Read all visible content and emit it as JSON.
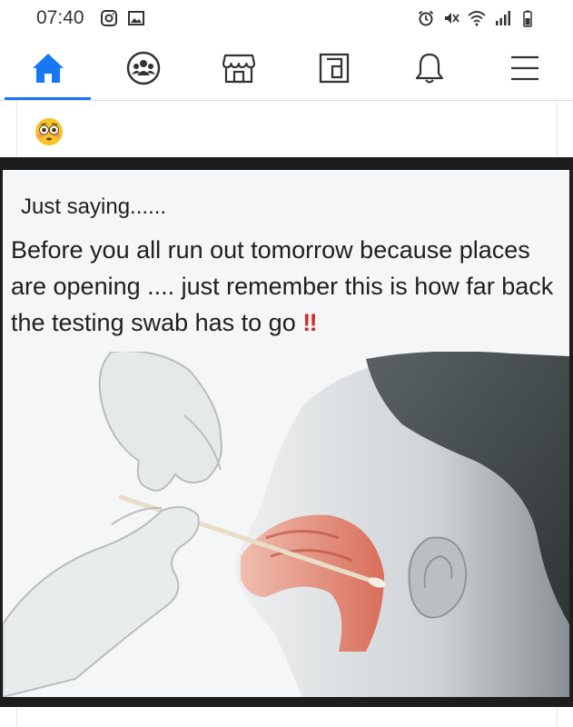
{
  "status_bar": {
    "time": "07:40",
    "left_icons": [
      "instagram-icon",
      "gallery-icon"
    ],
    "right_icons": [
      "alarm-icon",
      "mute-icon",
      "wifi-icon",
      "signal-icon",
      "battery-icon"
    ]
  },
  "nav": {
    "items": [
      {
        "name": "home",
        "icon": "home-icon",
        "active": true
      },
      {
        "name": "groups",
        "icon": "groups-icon",
        "active": false
      },
      {
        "name": "marketplace",
        "icon": "marketplace-icon",
        "active": false
      },
      {
        "name": "watch",
        "icon": "watch-icon",
        "active": false
      },
      {
        "name": "notifications",
        "icon": "bell-icon",
        "active": false
      },
      {
        "name": "menu",
        "icon": "menu-icon",
        "active": false
      }
    ],
    "active_color": "#1877f2"
  },
  "post": {
    "text_emoji": "flushed-face-emoji",
    "image": {
      "line1": "Just saying......",
      "line2": "Before you all run out tomorrow because places are opening .... just remember this is how far back the testing swab has to go",
      "exclaim": "‼"
    }
  }
}
